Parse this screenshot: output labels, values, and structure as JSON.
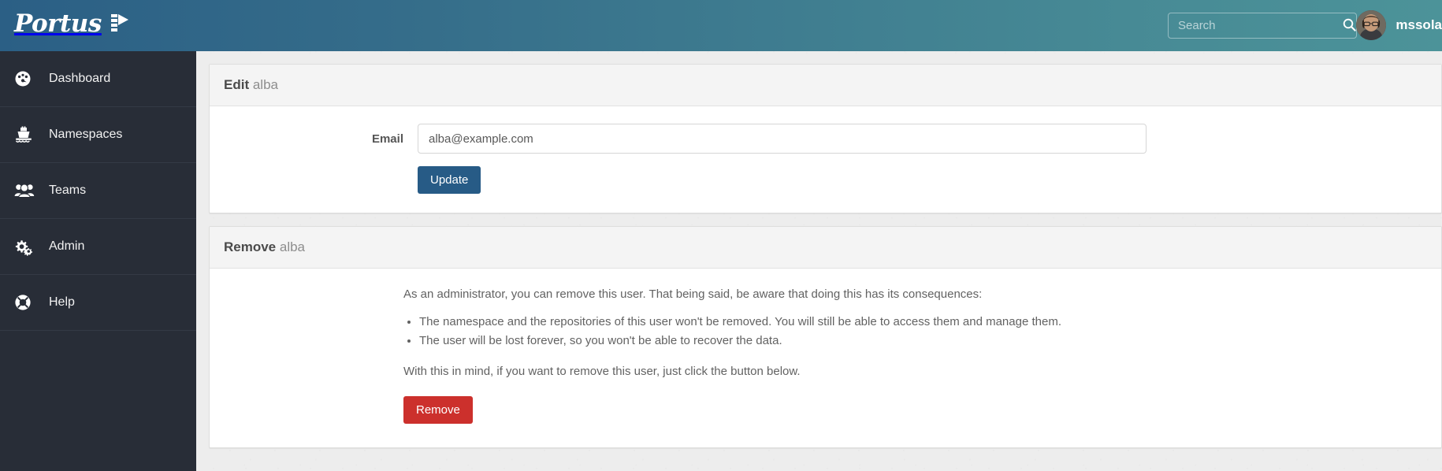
{
  "app": {
    "brand_name": "Portus",
    "brand_icon": "lighthouse-icon",
    "header_gradient_left": "#2b5f85",
    "header_gradient_right": "#4c9399",
    "sidebar_bg": "#282d37",
    "page_bg": "#ededed"
  },
  "header": {
    "search": {
      "placeholder": "Search",
      "value": "",
      "icon": "search-icon"
    },
    "user": {
      "username": "mssola",
      "avatar_icon": "user-avatar-photo"
    }
  },
  "sidebar": {
    "items": [
      {
        "label": "Dashboard",
        "icon": "dashboard-gauge-icon"
      },
      {
        "label": "Namespaces",
        "icon": "ship-icon"
      },
      {
        "label": "Teams",
        "icon": "users-group-icon"
      },
      {
        "label": "Admin",
        "icon": "gears-icon"
      },
      {
        "label": "Help",
        "icon": "life-ring-icon"
      }
    ]
  },
  "main": {
    "edit_panel": {
      "title_strong": "Edit",
      "title_light": "alba",
      "email_label": "Email",
      "email_value": "alba@example.com",
      "email_placeholder": "Email",
      "update_label": "Update",
      "update_color": "#275b86"
    },
    "remove_panel": {
      "title_strong": "Remove",
      "title_light": "alba",
      "intro": "As an administrator, you can remove this user. That being said, be aware that doing this has its consequences:",
      "bullets": [
        "The namespace and the repositories of this user won't be removed. You will still be able to access them and manage them.",
        "The user will be lost forever, so you won't be able to recover the data."
      ],
      "outro": "With this in mind, if you want to remove this user, just click the button below.",
      "remove_label": "Remove",
      "remove_color": "#cc302c"
    }
  }
}
